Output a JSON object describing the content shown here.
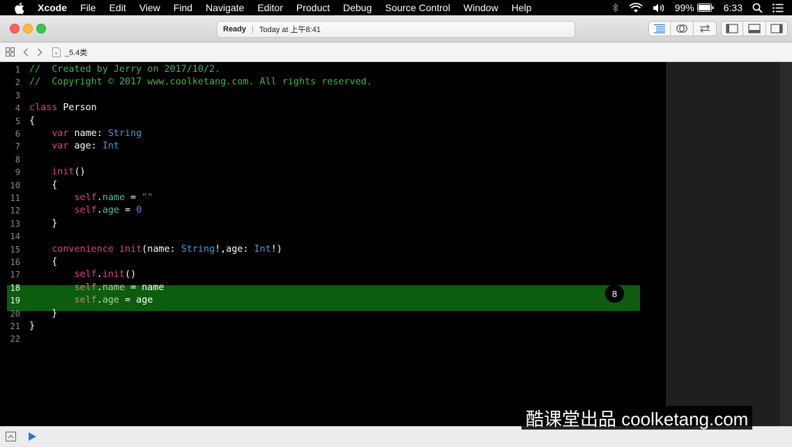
{
  "menubar": {
    "apple_icon": "apple-logo",
    "items": [
      "Xcode",
      "File",
      "Edit",
      "View",
      "Find",
      "Navigate",
      "Editor",
      "Product",
      "Debug",
      "Source Control",
      "Window",
      "Help"
    ],
    "battery": "99%",
    "clock": "6:33"
  },
  "toolbar": {
    "status": "Ready",
    "timestamp": "Today at 上午8:41"
  },
  "jumpbar": {
    "filename": "_5.4类"
  },
  "editor": {
    "lines": [
      {
        "n": "1",
        "tokens": [
          {
            "t": "//  Created by Jerry on 2017/10/2.",
            "c": "com"
          }
        ]
      },
      {
        "n": "2",
        "tokens": [
          {
            "t": "//  Copyright © 2017 www.coolketang.com. All rights reserved.",
            "c": "com"
          }
        ]
      },
      {
        "n": "3",
        "tokens": []
      },
      {
        "n": "4",
        "tokens": [
          {
            "t": "class",
            "c": "kw"
          },
          {
            "t": " Person",
            "c": "plain"
          }
        ]
      },
      {
        "n": "5",
        "tokens": [
          {
            "t": "{",
            "c": "plain"
          }
        ]
      },
      {
        "n": "6",
        "tokens": [
          {
            "t": "    ",
            "c": "plain"
          },
          {
            "t": "var",
            "c": "kw"
          },
          {
            "t": " name: ",
            "c": "plain"
          },
          {
            "t": "String",
            "c": "type"
          }
        ]
      },
      {
        "n": "7",
        "tokens": [
          {
            "t": "    ",
            "c": "plain"
          },
          {
            "t": "var",
            "c": "kw"
          },
          {
            "t": " age: ",
            "c": "plain"
          },
          {
            "t": "Int",
            "c": "type"
          }
        ]
      },
      {
        "n": "8",
        "tokens": []
      },
      {
        "n": "9",
        "tokens": [
          {
            "t": "    ",
            "c": "plain"
          },
          {
            "t": "init",
            "c": "kw"
          },
          {
            "t": "()",
            "c": "plain"
          }
        ]
      },
      {
        "n": "10",
        "tokens": [
          {
            "t": "    {",
            "c": "plain"
          }
        ]
      },
      {
        "n": "11",
        "tokens": [
          {
            "t": "        ",
            "c": "plain"
          },
          {
            "t": "self",
            "c": "kw"
          },
          {
            "t": ".",
            "c": "plain"
          },
          {
            "t": "name",
            "c": "prop"
          },
          {
            "t": " = ",
            "c": "plain"
          },
          {
            "t": "\"\"",
            "c": "str"
          }
        ]
      },
      {
        "n": "12",
        "tokens": [
          {
            "t": "        ",
            "c": "plain"
          },
          {
            "t": "self",
            "c": "kw"
          },
          {
            "t": ".",
            "c": "plain"
          },
          {
            "t": "age",
            "c": "prop"
          },
          {
            "t": " = ",
            "c": "plain"
          },
          {
            "t": "0",
            "c": "num"
          }
        ]
      },
      {
        "n": "13",
        "tokens": [
          {
            "t": "    }",
            "c": "plain"
          }
        ]
      },
      {
        "n": "14",
        "tokens": []
      },
      {
        "n": "15",
        "tokens": [
          {
            "t": "    ",
            "c": "plain"
          },
          {
            "t": "convenience",
            "c": "kw"
          },
          {
            "t": " ",
            "c": "plain"
          },
          {
            "t": "init",
            "c": "kw"
          },
          {
            "t": "(name: ",
            "c": "plain"
          },
          {
            "t": "String",
            "c": "type"
          },
          {
            "t": "!,age: ",
            "c": "plain"
          },
          {
            "t": "Int",
            "c": "type"
          },
          {
            "t": "!)",
            "c": "plain"
          }
        ]
      },
      {
        "n": "16",
        "tokens": [
          {
            "t": "    {",
            "c": "plain"
          }
        ]
      },
      {
        "n": "17",
        "tokens": [
          {
            "t": "        ",
            "c": "plain"
          },
          {
            "t": "self",
            "c": "kw"
          },
          {
            "t": ".",
            "c": "plain"
          },
          {
            "t": "init",
            "c": "kw"
          },
          {
            "t": "()",
            "c": "plain"
          }
        ]
      },
      {
        "n": "18",
        "hl": true,
        "tokens": [
          {
            "t": "        ",
            "c": "plain"
          },
          {
            "t": "self",
            "c": "selfdim"
          },
          {
            "t": ".",
            "c": "plain"
          },
          {
            "t": "name",
            "c": "propdim"
          },
          {
            "t": " = name",
            "c": "plain"
          }
        ]
      },
      {
        "n": "19",
        "hl": true,
        "tokens": [
          {
            "t": "        ",
            "c": "plain"
          },
          {
            "t": "self",
            "c": "selfdim"
          },
          {
            "t": ".",
            "c": "plain"
          },
          {
            "t": "age",
            "c": "propdim"
          },
          {
            "t": " = age",
            "c": "plain"
          }
        ]
      },
      {
        "n": "20",
        "tokens": [
          {
            "t": "    }",
            "c": "plain"
          }
        ]
      },
      {
        "n": "21",
        "tokens": [
          {
            "t": "}",
            "c": "plain"
          }
        ]
      },
      {
        "n": "22",
        "tokens": []
      }
    ],
    "badge": "8",
    "highlight_color": "#0d5c0f"
  },
  "watermark": "酷课堂出品 coolketang.com"
}
